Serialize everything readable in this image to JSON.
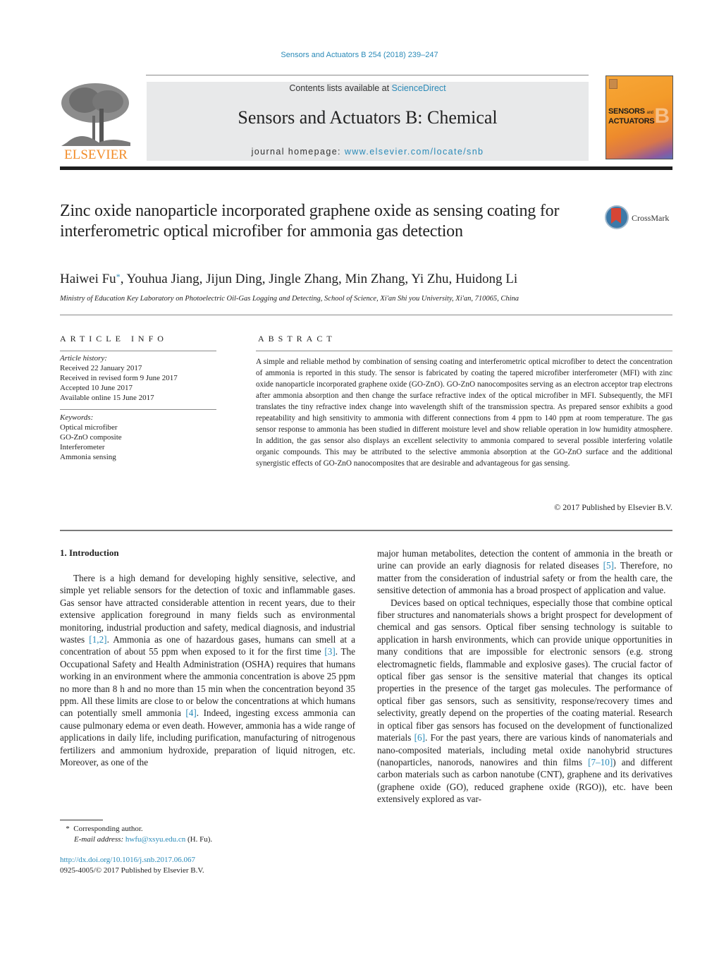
{
  "header": {
    "journal_ref": "Sensors and Actuators B 254 (2018) 239–247",
    "contents_prefix": "Contents lists available at ",
    "contents_link": "ScienceDirect",
    "journal_title": "Sensors and Actuators B: Chemical",
    "homepage_prefix": "journal homepage: ",
    "homepage_link": "www.elsevier.com/locate/snb",
    "publisher_logo_text": "ELSEVIER",
    "cover_line1": "SENSORS",
    "cover_and": "and",
    "cover_line2": "ACTUATORS",
    "cover_letter": "B"
  },
  "article": {
    "title": "Zinc oxide nanoparticle incorporated graphene oxide as sensing coating for interferometric optical microfiber for ammonia gas detection",
    "crossmark_label": "CrossMark",
    "first_author": "Haiwei Fu",
    "corresponding_marker": "*",
    "other_authors": ", Youhua Jiang, Jijun Ding, Jingle Zhang, Min Zhang, Yi Zhu, Huidong Li",
    "affiliation": "Ministry of Education Key Laboratory on Photoelectric Oil-Gas Logging and Detecting, School of Science, Xi'an Shi you University, Xi'an, 710065, China"
  },
  "article_info": {
    "heading": "ARTICLE INFO",
    "history_label": "Article history:",
    "history": [
      "Received 22 January 2017",
      "Received in revised form 9 June 2017",
      "Accepted 10 June 2017",
      "Available online 15 June 2017"
    ],
    "keywords_label": "Keywords:",
    "keywords": [
      "Optical microfiber",
      "GO-ZnO composite",
      "Interferometer",
      "Ammonia sensing"
    ]
  },
  "abstract": {
    "heading": "ABSTRACT",
    "text": "A simple and reliable method by combination of sensing coating and interferometric optical microfiber to detect the concentration of ammonia is reported in this study. The sensor is fabricated by coating the tapered microfiber interferometer (MFI) with zinc oxide nanoparticle incorporated graphene oxide (GO-ZnO). GO-ZnO nanocomposites serving as an electron acceptor trap electrons after ammonia absorption and then change the surface refractive index of the optical microfiber in MFI. Subsequently, the MFI translates the tiny refractive index change into wavelength shift of the transmission spectra. As prepared sensor exhibits a good repeatability and high sensitivity to ammonia with different connections from 4 ppm to 140 ppm at room temperature. The gas sensor response to ammonia has been studied in different moisture level and show reliable operation in low humidity atmosphere. In addition, the gas sensor also displays an excellent selectivity to ammonia compared to several possible interfering volatile organic compounds. This may be attributed to the selective ammonia absorption at the GO-ZnO surface and the additional synergistic effects of GO-ZnO nanocomposites that are desirable and advantageous for gas sensing.",
    "copyright": "© 2017 Published by Elsevier B.V."
  },
  "intro": {
    "heading": "1.  Introduction",
    "left_p1_a": "There is a high demand for developing highly sensitive, selective, and simple yet reliable sensors for the detection of toxic and inflammable gases. Gas sensor have attracted considerable attention in recent years, due to their extensive application foreground in many fields such as environmental monitoring, industrial production and safety, medical diagnosis, and industrial wastes ",
    "ref_1_2": "[1,2]",
    "left_p1_b": ". Ammonia as one of hazardous gases, humans can smell at a concentration of about 55 ppm when exposed to it for the first time ",
    "ref_3": "[3]",
    "left_p1_c": ". The Occupational Safety and Health Administration (OSHA) requires that humans working in an environment where the ammonia concentration is above 25 ppm no more than 8 h and no more than 15 min when the concentration beyond 35 ppm. All these limits are close to or below the concentrations at which humans can potentially smell ammonia ",
    "ref_4": "[4]",
    "left_p1_d": ". Indeed, ingesting excess ammonia can cause pulmonary edema or even death. However, ammonia has a wide range of applications in daily life, including purification, manufacturing of nitrogenous fertilizers and ammonium hydroxide, preparation of liquid nitrogen, etc. Moreover, as one of the",
    "right_p1_a": "major human metabolites, detection the content of ammonia in the breath or urine can provide an early diagnosis for related diseases ",
    "ref_5": "[5]",
    "right_p1_b": ". Therefore, no matter from the consideration of industrial safety or from the health care, the sensitive detection of ammonia has a broad prospect of application and value.",
    "right_p2_a": "Devices based on optical techniques, especially those that combine optical fiber structures and nanomaterials shows a bright prospect for development of chemical and gas sensors. Optical fiber sensing technology is suitable to application in harsh environments, which can provide unique opportunities in many conditions that are impossible for electronic sensors (e.g. strong electromagnetic fields, flammable and explosive gases). The crucial factor of optical fiber gas sensor is the sensitive material that changes its optical properties in the presence of the target gas molecules. The performance of optical fiber gas sensors, such as sensitivity, response/recovery times and selectivity, greatly depend on the properties of the coating material. Research in optical fiber gas sensors has focused on the development of functionalized materials ",
    "ref_6": "[6]",
    "right_p2_b": ". For the past years, there are various kinds of nanomaterials and nano-composited materials, including metal oxide nanohybrid structures (nanoparticles, nanorods, nanowires and thin films ",
    "ref_7_10": "[7–10]",
    "right_p2_c": ") and different carbon materials such as carbon nanotube (CNT), graphene and its derivatives (graphene oxide (GO), reduced graphene oxide (RGO)), etc. have been extensively explored as var-"
  },
  "footnote": {
    "marker": "*",
    "corresponding": "Corresponding author.",
    "email_label": "E-mail address:",
    "email": "hwfu@xsyu.edu.cn",
    "email_suffix": "(H. Fu).",
    "doi_link": "http://dx.doi.org/10.1016/j.snb.2017.06.067",
    "issn_line": "0925-4005/© 2017 Published by Elsevier B.V."
  }
}
